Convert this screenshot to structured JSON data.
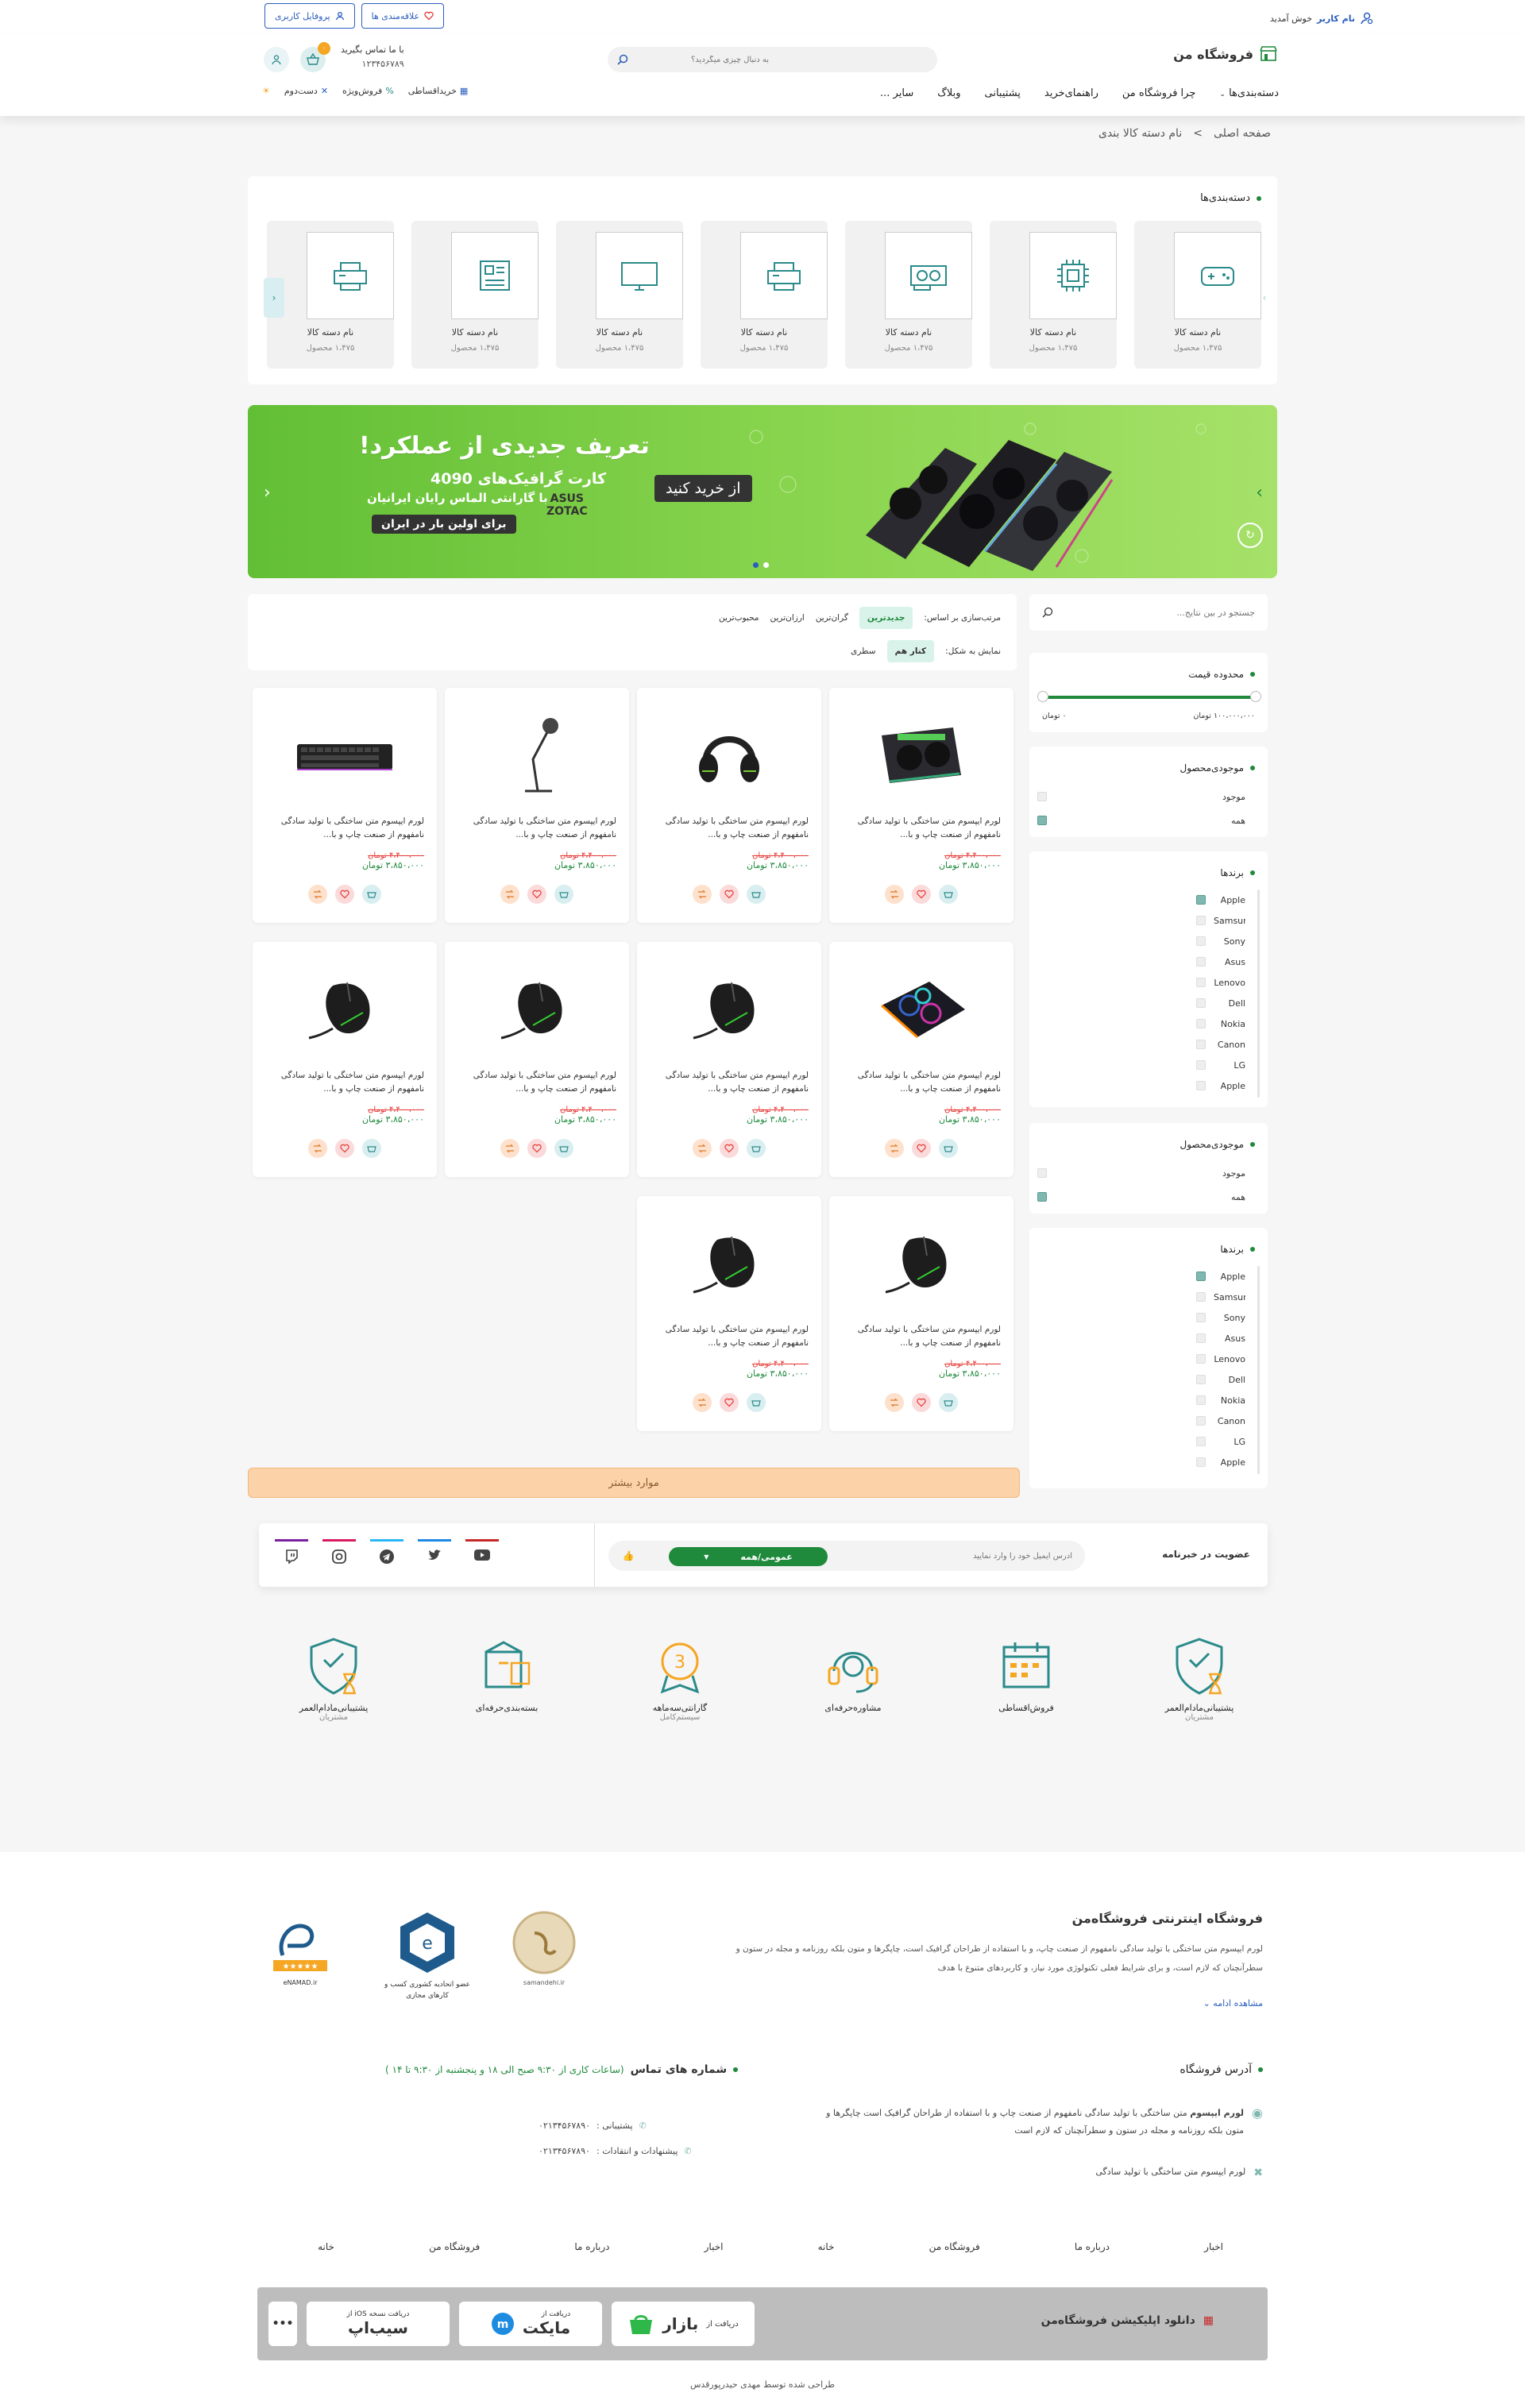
{
  "topbar": {
    "welcome_user": "نام کاربر",
    "welcome_text": "خوش آمدید",
    "profile_btn": "پروفایل کاربری",
    "favorites_btn": "علاقه‌مندی ها"
  },
  "header": {
    "store_name": "فروشگاه من",
    "search_placeholder": "به دنبال چیزی میگردید؟",
    "contact_label": "با ما تماس بگیرید",
    "contact_phone": "۱۲۳۴۵۶۷۸۹",
    "cart_count": "۰",
    "nav": [
      "دسته‌بندی‌ها",
      "چرا فروشگاه من",
      "راهنمای‌خرید",
      "پشتیبانی",
      "وبلاگ",
      "سایر ..."
    ],
    "quick_links": [
      "خریداقساطی",
      "فروش‌ویژه",
      "دست‌دوم"
    ]
  },
  "breadcrumb": {
    "home": "صفحه اصلی",
    "sep": ">",
    "current": "نام دسته کالا بندی"
  },
  "categories": {
    "title": "دسته‌بندی‌ها",
    "items": [
      {
        "name": "نام دسته کالا",
        "count": "۱،۴۷۵ محصول",
        "icon": "gamepad-icon"
      },
      {
        "name": "نام دسته کالا",
        "count": "۱،۴۷۵ محصول",
        "icon": "cpu-icon"
      },
      {
        "name": "نام دسته کالا",
        "count": "۱،۴۷۵ محصول",
        "icon": "gpu-icon"
      },
      {
        "name": "نام دسته کالا",
        "count": "۱،۴۷۵ محصول",
        "icon": "printer-icon"
      },
      {
        "name": "نام دسته کالا",
        "count": "۱،۴۷۵ محصول",
        "icon": "monitor-icon"
      },
      {
        "name": "نام دسته کالا",
        "count": "۱،۴۷۵ محصول",
        "icon": "motherboard-icon"
      },
      {
        "name": "نام دسته کالا",
        "count": "۱،۴۷۵ محصول",
        "icon": "printer-icon"
      }
    ]
  },
  "banner": {
    "headline": "تعریف جدیدی از عملکرد!",
    "line1": "کارت گرافیک‌های 4090",
    "line2": "با گارانتی الماس رایان ایرانیان",
    "line3": "برای اولین بار در ایران",
    "cta": "از خرید کنید",
    "brand1": "ASUS",
    "brand2": "ZOTAC",
    "accent": "#6cc33a"
  },
  "sorting": {
    "label": "مرتب‌سازی بر اساس:",
    "options": [
      "جدیدترین",
      "گران‌ترین",
      "ارزان‌ترین",
      "محبوب‌ترین"
    ],
    "display_label": "نمایش به شکل:",
    "display_options": [
      "کنار هم",
      "سطری"
    ]
  },
  "products": [
    {
      "desc": "لورم ایپسوم متن ساختگی با تولید سادگی نامفهوم از صنعت چاپ و با...",
      "old_price": "۴،۴۰۰،۰۰۰ تومان",
      "price": "۳،۸۵۰،۰۰۰ تومان",
      "img": "gpu"
    },
    {
      "desc": "لورم ایپسوم متن ساختگی با تولید سادگی نامفهوم از صنعت چاپ و با...",
      "old_price": "۴،۴۰۰،۰۰۰ تومان",
      "price": "۳،۸۵۰،۰۰۰ تومان",
      "img": "headset"
    },
    {
      "desc": "لورم ایپسوم متن ساختگی با تولید سادگی نامفهوم از صنعت چاپ و با...",
      "old_price": "۴،۴۰۰،۰۰۰ تومان",
      "price": "۳،۸۵۰،۰۰۰ تومان",
      "img": "mic"
    },
    {
      "desc": "لورم ایپسوم متن ساختگی با تولید سادگی نامفهوم از صنعت چاپ و با...",
      "old_price": "۴،۴۰۰،۰۰۰ تومان",
      "price": "۳،۸۵۰،۰۰۰ تومان",
      "img": "keyboard"
    },
    {
      "desc": "لورم ایپسوم متن ساختگی با تولید سادگی نامفهوم از صنعت چاپ و با...",
      "old_price": "۴،۴۰۰،۰۰۰ تومان",
      "price": "۳،۸۵۰،۰۰۰ تومان",
      "img": "coolpad"
    },
    {
      "desc": "لورم ایپسوم متن ساختگی با تولید سادگی نامفهوم از صنعت چاپ و با...",
      "old_price": "۴،۴۰۰،۰۰۰ تومان",
      "price": "۳،۸۵۰،۰۰۰ تومان",
      "img": "mouse"
    },
    {
      "desc": "لورم ایپسوم متن ساختگی با تولید سادگی نامفهوم از صنعت چاپ و با...",
      "old_price": "۴،۴۰۰،۰۰۰ تومان",
      "price": "۳،۸۵۰،۰۰۰ تومان",
      "img": "mouse"
    },
    {
      "desc": "لورم ایپسوم متن ساختگی با تولید سادگی نامفهوم از صنعت چاپ و با...",
      "old_price": "۴،۴۰۰،۰۰۰ تومان",
      "price": "۳،۸۵۰،۰۰۰ تومان",
      "img": "mouse"
    },
    {
      "desc": "لورم ایپسوم متن ساختگی با تولید سادگی نامفهوم از صنعت چاپ و با...",
      "old_price": "۴،۴۰۰،۰۰۰ تومان",
      "price": "۳،۸۵۰،۰۰۰ تومان",
      "img": "mouse"
    },
    {
      "desc": "لورم ایپسوم متن ساختگی با تولید سادگی نامفهوم از صنعت چاپ و با...",
      "old_price": "۴،۴۰۰،۰۰۰ تومان",
      "price": "۳،۸۵۰،۰۰۰ تومان",
      "img": "mouse"
    }
  ],
  "load_more": "موارد بیشتر",
  "filters": {
    "search_placeholder": "جستجو در بین نتایج...",
    "price_title": "محدوده قیمت",
    "price_max": "۱۰۰،۰۰۰،۰۰۰ تومان",
    "price_min": "۰ تومان",
    "availability_title": "موجودی‌محصول",
    "availability": [
      {
        "label": "موجود",
        "checked": false
      },
      {
        "label": "همه",
        "checked": true
      }
    ],
    "brands_title": "برندها",
    "brands": [
      {
        "label": "Apple",
        "checked": true
      },
      {
        "label": "Samsung",
        "checked": false
      },
      {
        "label": "Sony",
        "checked": false
      },
      {
        "label": "Asus",
        "checked": false
      },
      {
        "label": "Lenovo",
        "checked": false
      },
      {
        "label": "Dell",
        "checked": false
      },
      {
        "label": "Nokia",
        "checked": false
      },
      {
        "label": "Canon",
        "checked": false
      },
      {
        "label": "LG",
        "checked": false
      },
      {
        "label": "Apple",
        "checked": false
      }
    ]
  },
  "newsletter": {
    "title": "عضویت در خبرنامه",
    "placeholder": "آدرس ایمیل خود را وارد نمایید",
    "select": "عمومی/همه"
  },
  "features": [
    {
      "title": "پشتیبانی‌مادام‌العمر",
      "sub": "مشتریان",
      "icon": "shield-hourglass-icon"
    },
    {
      "title": "بسته‌بندی‌حرفه‌ای",
      "sub": "",
      "icon": "package-icon"
    },
    {
      "title": "گارانتی‌سه‌ماهه",
      "sub": "سیستم‌کامل",
      "icon": "badge-3-icon"
    },
    {
      "title": "مشاوره‌حرفه‌ای",
      "sub": "",
      "icon": "headset-support-icon"
    },
    {
      "title": "فروش‌اقساطی",
      "sub": "",
      "icon": "calendar-icon"
    },
    {
      "title": "پشتیبانی‌مادام‌العمر",
      "sub": "مشتریان",
      "icon": "shield-hourglass-icon"
    }
  ],
  "footer": {
    "about_title": "فروشگاه اینترنتی فروشگاه‌من",
    "about_text": "لورم ایپسوم متن ساختگی با تولید سادگی نامفهوم از صنعت چاپ، و با استفاده از طراحان گرافیک است، چاپگرها و متون بلکه روزنامه و مجله در ستون و سطرآنچنان که لازم است، و برای شرایط فعلی تکنولوژی مورد نیاز، و کاربردهای متنوع با هدف",
    "show_more": "مشاهده ادامه",
    "badges": [
      "samandehi.ir",
      "عضو اتحادیه کشوری کسب و کارهای مجازی",
      "eNAMAD.ir"
    ],
    "address_title": "آدرس فروشگاه",
    "address_line1_bold": "لورم ایپسوم",
    "address_line1": "متن ساختگی با تولید سادگی نامفهوم از صنعت چاپ و با استفاده از طراحان گرافیک است چاپگرها و متون بلکه روزنامه و مجله در ستون و سطرآنچنان که لازم است",
    "address_line2": "لورم ایپسوم متن ساختگی با تولید سادگی",
    "contact_title": "شماره های تماس",
    "contact_hours": "(ساعات کاری از ۹:۳۰ صبح الی ۱۸ و پنجشنبه از ۹:۳۰ تا ۱۴ )",
    "support_label": "پشتیبانی :",
    "support_phone": "۰۲۱۳۴۵۶۷۸۹۰",
    "suggest_label": "پیشنهادات و انتقادات :",
    "suggest_phone": "۰۲۱۳۴۵۶۷۸۹۰",
    "nav": [
      "خانه",
      "فروشگاه من",
      "درباره ما",
      "اخبار",
      "خانه",
      "فروشگاه من",
      "درباره ما",
      "اخبار"
    ],
    "app_title": "دانلود اپلیکیشن فروشگاه‌من",
    "app_stores": [
      {
        "top": "دریافت از",
        "name": "بازار"
      },
      {
        "top": "دریافت از",
        "name": "مایکت"
      },
      {
        "top": "دریافت نسخه iOS از",
        "name": "سیب‌اپ"
      }
    ],
    "more": "•••",
    "credit": "طراحی شده توسط مهدی حیدرپورقدس"
  },
  "colors": {
    "primary": "#1f8a3c",
    "blue": "#2b5dbd",
    "danger": "#e53935",
    "load_more_bg": "#fcd2a8"
  }
}
